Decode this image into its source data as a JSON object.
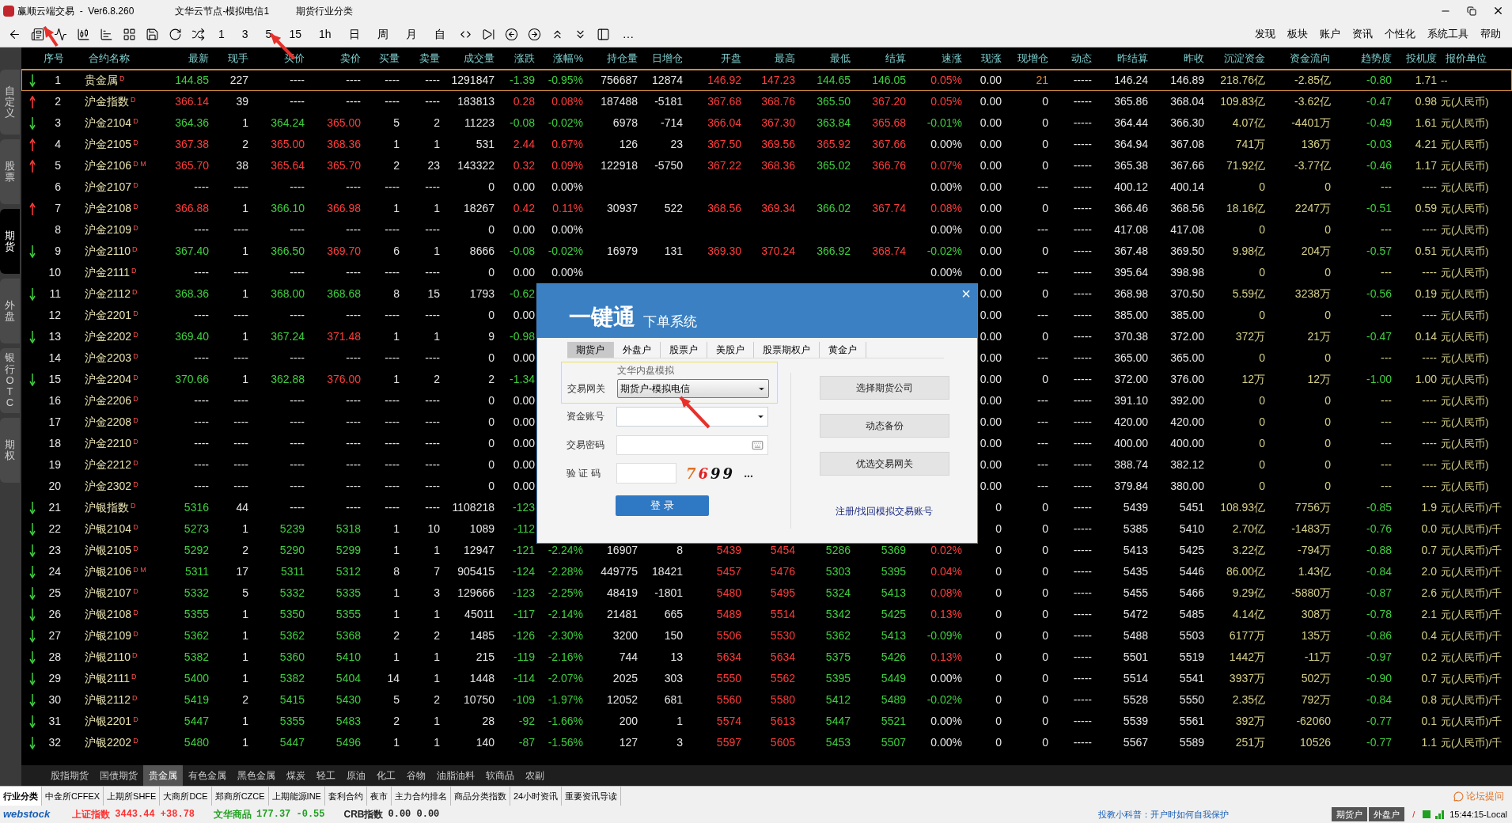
{
  "window": {
    "title": "赢顺云端交易  -  Ver6.8.260",
    "node": "文华云节点-模拟电信1",
    "category": "期货行业分类"
  },
  "menu": [
    "发现",
    "板块",
    "账户",
    "资讯",
    "个性化",
    "系统工具",
    "帮助"
  ],
  "toolbar": {
    "periods": [
      "1",
      "3",
      "5",
      "15",
      "1h",
      "日",
      "周",
      "月",
      "自"
    ],
    "more": "…"
  },
  "side_tabs": [
    {
      "label": "自定义",
      "selected": false
    },
    {
      "label": "股票",
      "selected": false
    },
    {
      "label": "期货",
      "selected": true
    },
    {
      "label": "外盘",
      "selected": false
    },
    {
      "label": "银行OTC",
      "selected": false
    },
    {
      "label": "期权",
      "selected": false
    }
  ],
  "table": {
    "columns": [
      "序号",
      "合约名称",
      "最新",
      "现手",
      "买价",
      "卖价",
      "买量",
      "卖量",
      "成交量",
      "涨跌",
      "涨幅%",
      "持仓量",
      "日增仓",
      "开盘",
      "最高",
      "最低",
      "结算",
      "速涨",
      "现涨",
      "现增仓",
      "动态",
      "昨结算",
      "昨收",
      "沉淀资金",
      "资金流向",
      "趋势度",
      "投机度",
      "报价单位"
    ],
    "rows": [
      {
        "selected": true,
        "cells": [
          "1",
          "贵金属$^{D}$",
          "144.85",
          "227",
          "----",
          "----",
          "----",
          "----",
          "1291847",
          "-1.39",
          "-0.95%",
          "756687",
          "12874",
          "146.92",
          "147.23",
          "144.65",
          "146.05",
          "0.05%",
          "0.00",
          "21",
          "-----",
          "146.24",
          "146.89",
          "218.76亿",
          "-2.85亿",
          "-0.80",
          "1.71",
          "--"
        ]
      },
      {
        "selected": false,
        "cells": [
          "2",
          "沪金指数$^{D}$",
          "366.14",
          "39",
          "----",
          "----",
          "----",
          "----",
          "183813",
          "0.28",
          "0.08%",
          "187488",
          "-5181",
          "367.68",
          "368.76",
          "365.50",
          "367.20",
          "0.05%",
          "0.00",
          "0",
          "-----",
          "365.86",
          "368.04",
          "109.83亿",
          "-3.62亿",
          "-0.47",
          "0.98",
          "元(人民币)"
        ]
      },
      {
        "selected": false,
        "cells": [
          "3",
          "沪金2104$^{D}$",
          "364.36",
          "1",
          "364.24",
          "365.00",
          "5",
          "2",
          "11223",
          "-0.08",
          "-0.02%",
          "6978",
          "-714",
          "366.04",
          "367.30",
          "363.84",
          "365.68",
          "-0.01%",
          "0.00",
          "0",
          "-----",
          "364.44",
          "366.30",
          "4.07亿",
          "-4401万",
          "-0.49",
          "1.61",
          "元(人民币)"
        ]
      },
      {
        "selected": false,
        "cells": [
          "4",
          "沪金2105$^{D}$",
          "367.38",
          "2",
          "365.00",
          "368.36",
          "1",
          "1",
          "531",
          "2.44",
          "0.67%",
          "126",
          "23",
          "367.50",
          "369.56",
          "365.92",
          "367.66",
          "0.00%",
          "0.00",
          "0",
          "-----",
          "364.94",
          "367.08",
          "741万",
          "136万",
          "-0.03",
          "4.21",
          "元(人民币)"
        ]
      },
      {
        "selected": false,
        "cells": [
          "5",
          "沪金2106$^{D M}$",
          "365.70",
          "38",
          "365.64",
          "365.70",
          "2",
          "23",
          "143322",
          "0.32",
          "0.09%",
          "122918",
          "-5750",
          "367.22",
          "368.36",
          "365.02",
          "366.76",
          "0.07%",
          "0.00",
          "0",
          "-----",
          "365.38",
          "367.66",
          "71.92亿",
          "-3.77亿",
          "-0.46",
          "1.17",
          "元(人民币)"
        ]
      },
      {
        "selected": false,
        "cells": [
          "6",
          "沪金2107$^{D}$",
          "----",
          "----",
          "----",
          "----",
          "----",
          "----",
          "0",
          "0.00",
          "0.00%",
          null,
          null,
          null,
          null,
          null,
          null,
          "0.00%",
          "0.00",
          "---",
          "-----",
          "400.12",
          "400.14",
          "0",
          "0",
          "---",
          "----",
          "元(人民币)"
        ]
      },
      {
        "selected": false,
        "cells": [
          "7",
          "沪金2108$^{D}$",
          "366.88",
          "1",
          "366.10",
          "366.98",
          "1",
          "1",
          "18267",
          "0.42",
          "0.11%",
          "30937",
          "522",
          "368.56",
          "369.34",
          "366.02",
          "367.74",
          "0.08%",
          "0.00",
          "0",
          "-----",
          "366.46",
          "368.56",
          "18.16亿",
          "2247万",
          "-0.51",
          "0.59",
          "元(人民币)"
        ]
      },
      {
        "selected": false,
        "cells": [
          "8",
          "沪金2109$^{D}$",
          "----",
          "----",
          "----",
          "----",
          "----",
          "----",
          "0",
          "0.00",
          "0.00%",
          null,
          null,
          null,
          null,
          null,
          null,
          "0.00%",
          "0.00",
          "---",
          "-----",
          "417.08",
          "417.08",
          "0",
          "0",
          "---",
          "----",
          "元(人民币)"
        ]
      },
      {
        "selected": false,
        "cells": [
          "9",
          "沪金2110$^{D}$",
          "367.40",
          "1",
          "366.50",
          "369.70",
          "6",
          "1",
          "8666",
          "-0.08",
          "-0.02%",
          "16979",
          "131",
          "369.30",
          "370.24",
          "366.92",
          "368.74",
          "-0.02%",
          "0.00",
          "0",
          "-----",
          "367.48",
          "369.50",
          "9.98亿",
          "204万",
          "-0.57",
          "0.51",
          "元(人民币)"
        ]
      },
      {
        "selected": false,
        "cells": [
          "10",
          "沪金2111$^{D}$",
          "----",
          "----",
          "----",
          "----",
          "----",
          "----",
          "0",
          "0.00",
          "0.00%",
          null,
          null,
          null,
          null,
          null,
          null,
          "0.00%",
          "0.00",
          "---",
          "-----",
          "395.64",
          "398.98",
          "0",
          "0",
          "---",
          "----",
          "元(人民币)"
        ]
      },
      {
        "selected": false,
        "cells": [
          "11",
          "沪金2112$^{D}$",
          "368.36",
          "1",
          "368.00",
          "368.68",
          "8",
          "15",
          "1793",
          "-0.62",
          null,
          null,
          null,
          null,
          null,
          null,
          null,
          null,
          "0.00",
          "0",
          "-----",
          "368.98",
          "370.50",
          "5.59亿",
          "3238万",
          "-0.56",
          "0.19",
          "元(人民币)"
        ]
      },
      {
        "selected": false,
        "cells": [
          "12",
          "沪金2201$^{D}$",
          "----",
          "----",
          "----",
          "----",
          "----",
          "----",
          "0",
          "0.00",
          null,
          null,
          null,
          null,
          null,
          null,
          null,
          null,
          "0.00",
          "---",
          "-----",
          "385.00",
          "385.00",
          "0",
          "0",
          "---",
          "----",
          "元(人民币)"
        ]
      },
      {
        "selected": false,
        "cells": [
          "13",
          "沪金2202$^{D}$",
          "369.40",
          "1",
          "367.24",
          "371.48",
          "1",
          "1",
          "9",
          "-0.98",
          null,
          null,
          null,
          null,
          null,
          null,
          null,
          null,
          "0.00",
          "0",
          "-----",
          "370.38",
          "372.00",
          "372万",
          "21万",
          "-0.47",
          "0.14",
          "元(人民币)"
        ]
      },
      {
        "selected": false,
        "cells": [
          "14",
          "沪金2203$^{D}$",
          "----",
          "----",
          "----",
          "----",
          "----",
          "----",
          "0",
          "0.00",
          null,
          null,
          null,
          null,
          null,
          null,
          null,
          null,
          "0.00",
          "---",
          "-----",
          "365.00",
          "365.00",
          "0",
          "0",
          "---",
          "----",
          "元(人民币)"
        ]
      },
      {
        "selected": false,
        "cells": [
          "15",
          "沪金2204$^{D}$",
          "370.66",
          "1",
          "362.88",
          "376.00",
          "1",
          "2",
          "2",
          "-1.34",
          null,
          null,
          null,
          null,
          null,
          null,
          null,
          null,
          "0.00",
          "0",
          "-----",
          "372.00",
          "376.00",
          "12万",
          "12万",
          "-1.00",
          "1.00",
          "元(人民币)"
        ]
      },
      {
        "selected": false,
        "cells": [
          "16",
          "沪金2206$^{D}$",
          "----",
          "----",
          "----",
          "----",
          "----",
          "----",
          "0",
          "0.00",
          null,
          null,
          null,
          null,
          null,
          null,
          null,
          null,
          "0.00",
          "---",
          "-----",
          "391.10",
          "392.00",
          "0",
          "0",
          "---",
          "----",
          "元(人民币)"
        ]
      },
      {
        "selected": false,
        "cells": [
          "17",
          "沪金2208$^{D}$",
          "----",
          "----",
          "----",
          "----",
          "----",
          "----",
          "0",
          "0.00",
          null,
          null,
          null,
          null,
          null,
          null,
          null,
          null,
          "0.00",
          "---",
          "-----",
          "420.00",
          "420.00",
          "0",
          "0",
          "---",
          "----",
          "元(人民币)"
        ]
      },
      {
        "selected": false,
        "cells": [
          "18",
          "沪金2210$^{D}$",
          "----",
          "----",
          "----",
          "----",
          "----",
          "----",
          "0",
          "0.00",
          null,
          null,
          null,
          null,
          null,
          null,
          null,
          null,
          "0.00",
          "---",
          "-----",
          "400.00",
          "400.00",
          "0",
          "0",
          "---",
          "----",
          "元(人民币)"
        ]
      },
      {
        "selected": false,
        "cells": [
          "19",
          "沪金2212$^{D}$",
          "----",
          "----",
          "----",
          "----",
          "----",
          "----",
          "0",
          "0.00",
          null,
          null,
          null,
          null,
          null,
          null,
          null,
          null,
          "0.00",
          "---",
          "-----",
          "388.74",
          "382.12",
          "0",
          "0",
          "---",
          "----",
          "元(人民币)"
        ]
      },
      {
        "selected": false,
        "cells": [
          "20",
          "沪金2302$^{D}$",
          "----",
          "----",
          "----",
          "----",
          "----",
          "----",
          "0",
          "0.00",
          null,
          null,
          null,
          null,
          null,
          null,
          null,
          null,
          "0.00",
          "---",
          "-----",
          "379.84",
          "380.00",
          "0",
          "0",
          "---",
          "----",
          "元(人民币)"
        ]
      },
      {
        "selected": false,
        "cells": [
          "21",
          "沪银指数$^{D}$",
          "5316",
          "44",
          "----",
          "----",
          "----",
          "----",
          "1108218",
          "-123",
          null,
          null,
          null,
          null,
          null,
          null,
          null,
          null,
          "0",
          "0",
          "-----",
          "5439",
          "5451",
          "108.93亿",
          "7756万",
          "-0.85",
          "1.9",
          "元(人民币)/千"
        ]
      },
      {
        "selected": false,
        "cells": [
          "22",
          "沪银2104$^{D}$",
          "5273",
          "1",
          "5239",
          "5318",
          "1",
          "10",
          "1089",
          "-112",
          null,
          null,
          null,
          null,
          null,
          null,
          null,
          null,
          "0",
          "0",
          "-----",
          "5385",
          "5410",
          "2.70亿",
          "-1483万",
          "-0.76",
          "0.0",
          "元(人民币)/千"
        ]
      },
      {
        "selected": false,
        "cells": [
          "23",
          "沪银2105$^{D}$",
          "5292",
          "2",
          "5290",
          "5299",
          "1",
          "1",
          "12947",
          "-121",
          "-2.24%",
          "16907",
          "8",
          "5439",
          "5454",
          "5286",
          "5369",
          "0.02%",
          "0",
          "0",
          "-----",
          "5413",
          "5425",
          "3.22亿",
          "-794万",
          "-0.88",
          "0.7",
          "元(人民币)/千"
        ]
      },
      {
        "selected": false,
        "cells": [
          "24",
          "沪银2106$^{D M}$",
          "5311",
          "17",
          "5311",
          "5312",
          "8",
          "7",
          "905415",
          "-124",
          "-2.28%",
          "449775",
          "18421",
          "5457",
          "5476",
          "5303",
          "5395",
          "0.04%",
          "0",
          "0",
          "-----",
          "5435",
          "5446",
          "86.00亿",
          "1.43亿",
          "-0.84",
          "2.0",
          "元(人民币)/千"
        ]
      },
      {
        "selected": false,
        "cells": [
          "25",
          "沪银2107$^{D}$",
          "5332",
          "5",
          "5332",
          "5335",
          "1",
          "3",
          "129666",
          "-123",
          "-2.25%",
          "48419",
          "-1801",
          "5480",
          "5495",
          "5324",
          "5413",
          "0.08%",
          "0",
          "0",
          "-----",
          "5455",
          "5466",
          "9.29亿",
          "-5880万",
          "-0.87",
          "2.6",
          "元(人民币)/千"
        ]
      },
      {
        "selected": false,
        "cells": [
          "26",
          "沪银2108$^{D}$",
          "5355",
          "1",
          "5350",
          "5355",
          "1",
          "1",
          "45011",
          "-117",
          "-2.14%",
          "21481",
          "665",
          "5489",
          "5514",
          "5342",
          "5425",
          "0.13%",
          "0",
          "0",
          "-----",
          "5472",
          "5485",
          "4.14亿",
          "308万",
          "-0.78",
          "2.1",
          "元(人民币)/千"
        ]
      },
      {
        "selected": false,
        "cells": [
          "27",
          "沪银2109$^{D}$",
          "5362",
          "1",
          "5362",
          "5368",
          "2",
          "2",
          "1485",
          "-126",
          "-2.30%",
          "3200",
          "150",
          "5506",
          "5530",
          "5362",
          "5413",
          "-0.09%",
          "0",
          "0",
          "-----",
          "5488",
          "5503",
          "6177万",
          "135万",
          "-0.86",
          "0.4",
          "元(人民币)/千"
        ]
      },
      {
        "selected": false,
        "cells": [
          "28",
          "沪银2110$^{D}$",
          "5382",
          "1",
          "5360",
          "5410",
          "1",
          "1",
          "215",
          "-119",
          "-2.16%",
          "744",
          "13",
          "5634",
          "5634",
          "5375",
          "5426",
          "0.13%",
          "0",
          "0",
          "-----",
          "5501",
          "5519",
          "1442万",
          "-11万",
          "-0.97",
          "0.2",
          "元(人民币)/千"
        ]
      },
      {
        "selected": false,
        "cells": [
          "29",
          "沪银2111$^{D}$",
          "5400",
          "1",
          "5382",
          "5404",
          "14",
          "1",
          "1448",
          "-114",
          "-2.07%",
          "2025",
          "303",
          "5550",
          "5562",
          "5395",
          "5449",
          "0.00%",
          "0",
          "0",
          "-----",
          "5514",
          "5541",
          "3937万",
          "502万",
          "-0.90",
          "0.7",
          "元(人民币)/千"
        ]
      },
      {
        "selected": false,
        "cells": [
          "30",
          "沪银2112$^{D}$",
          "5419",
          "2",
          "5415",
          "5430",
          "5",
          "2",
          "10750",
          "-109",
          "-1.97%",
          "12052",
          "681",
          "5560",
          "5580",
          "5412",
          "5489",
          "-0.02%",
          "0",
          "0",
          "-----",
          "5528",
          "5550",
          "2.35亿",
          "792万",
          "-0.84",
          "0.8",
          "元(人民币)/千"
        ]
      },
      {
        "selected": false,
        "cells": [
          "31",
          "沪银2201$^{D}$",
          "5447",
          "1",
          "5355",
          "5483",
          "2",
          "1",
          "28",
          "-92",
          "-1.66%",
          "200",
          "1",
          "5574",
          "5613",
          "5447",
          "5521",
          "0.00%",
          "0",
          "0",
          "-----",
          "5539",
          "5561",
          "392万",
          "-62060",
          "-0.77",
          "0.1",
          "元(人民币)/千"
        ]
      },
      {
        "selected": false,
        "cells": [
          "32",
          "沪银2202$^{D}$",
          "5480",
          "1",
          "5447",
          "5496",
          "1",
          "1",
          "140",
          "-87",
          "-1.56%",
          "127",
          "3",
          "5597",
          "5605",
          "5453",
          "5507",
          "0.00%",
          "0",
          "0",
          "-----",
          "5567",
          "5589",
          "251万",
          "10526",
          "-0.77",
          "1.1",
          "元(人民币)/千"
        ]
      }
    ]
  },
  "dialog": {
    "title": "一键通",
    "subtitle": "下单系统",
    "close": "×",
    "tabs": [
      {
        "label": "期货户",
        "selected": true
      },
      {
        "label": "外盘户",
        "selected": false
      },
      {
        "label": "股票户",
        "selected": false
      },
      {
        "label": "美股户",
        "selected": false
      },
      {
        "label": "股票期权户",
        "selected": false
      },
      {
        "label": "黄金户",
        "selected": false
      }
    ],
    "server_caption": "文华内盘模拟",
    "gateway_label": "交易网关",
    "gateway_value": "期货户-模拟电信",
    "account_label": "资金账号",
    "password_label": "交易密码",
    "captcha_label": "验 证 码",
    "captcha": [
      {
        "char": "7",
        "color": "#e07020"
      },
      {
        "char": "6",
        "color": "#e02020"
      },
      {
        "char": "9",
        "color": "#101010"
      },
      {
        "char": "9",
        "color": "#101010"
      }
    ],
    "captcha_more": "...",
    "login": "登 录",
    "side_buttons": [
      "选择期货公司",
      "动态备份",
      "优选交易网关"
    ],
    "register_link": "注册/找回模拟交易账号"
  },
  "category_tabs": [
    {
      "label": "股指期货",
      "selected": false
    },
    {
      "label": "国债期货",
      "selected": false
    },
    {
      "label": "贵金属",
      "selected": true
    },
    {
      "label": "有色金属",
      "selected": false
    },
    {
      "label": "黑色金属",
      "selected": false
    },
    {
      "label": "煤炭",
      "selected": false
    },
    {
      "label": "轻工",
      "selected": false
    },
    {
      "label": "原油",
      "selected": false
    },
    {
      "label": "化工",
      "selected": false
    },
    {
      "label": "谷物",
      "selected": false
    },
    {
      "label": "油脂油料",
      "selected": false
    },
    {
      "label": "软商品",
      "selected": false
    },
    {
      "label": "农副",
      "selected": false
    }
  ],
  "exchange_tabs": [
    {
      "label": "行业分类",
      "selected": true
    },
    {
      "label": "中金所CFFEX",
      "selected": false
    },
    {
      "label": "上期所SHFE",
      "selected": false
    },
    {
      "label": "大商所DCE",
      "selected": false
    },
    {
      "label": "郑商所CZCE",
      "selected": false
    },
    {
      "label": "上期能源INE",
      "selected": false
    },
    {
      "label": "套利合约",
      "selected": false
    },
    {
      "label": "夜市",
      "selected": false
    },
    {
      "label": "主力合约排名",
      "selected": false
    },
    {
      "label": "商品分类指数",
      "selected": false
    },
    {
      "label": "24小时资讯",
      "selected": false
    },
    {
      "label": "重要资讯导读",
      "selected": false
    }
  ],
  "forum_link": "论坛提问",
  "status_bar": {
    "logo": "webstock",
    "indices": [
      {
        "name": "上证指数",
        "value": "3443.44 +38.78",
        "color": "#ff3030"
      },
      {
        "name": "文华商品",
        "value": "177.37 -0.55",
        "color": "#20a020"
      },
      {
        "name": "CRB指数",
        "value": "0.00 0.00",
        "color": "#222222"
      }
    ],
    "tip": "投教小科普：开户时如何自我保护",
    "accounts": [
      "期货户",
      "外盘户"
    ],
    "separator": "/",
    "time": "15:44:15-Local"
  }
}
